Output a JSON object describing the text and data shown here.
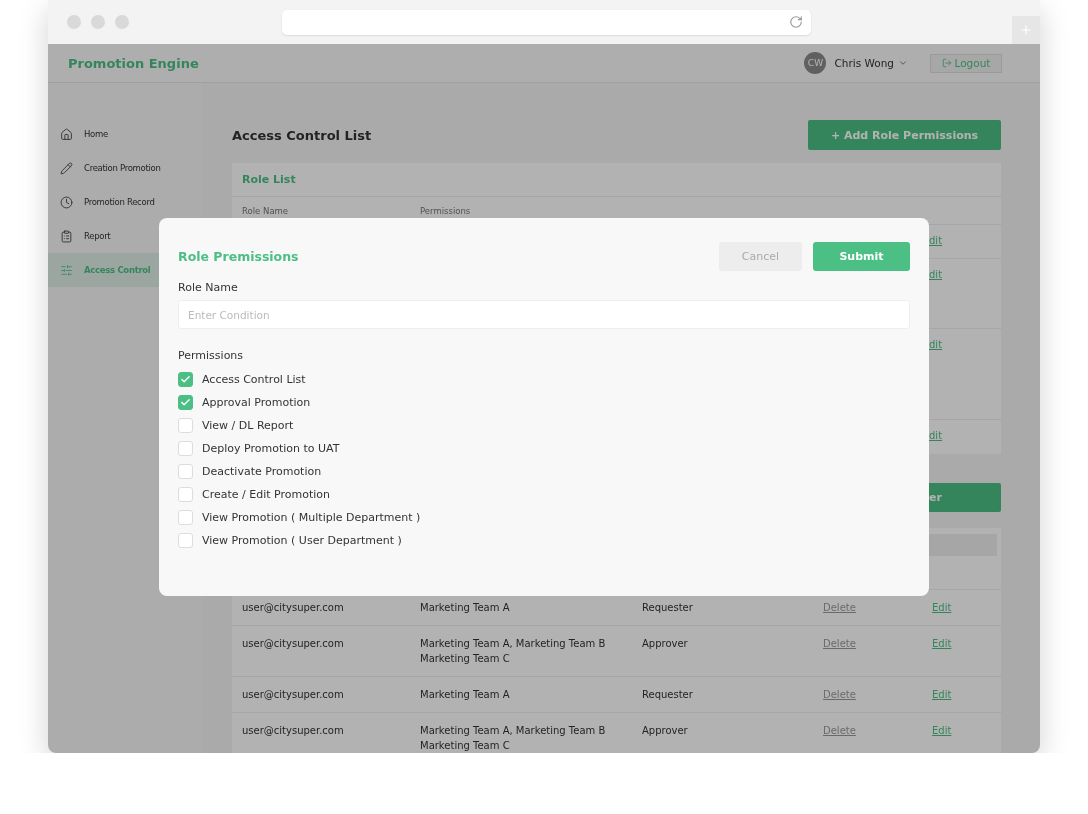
{
  "app": {
    "title": "Promotion Engine",
    "user": {
      "initials": "CW",
      "name": "Chris Wong"
    },
    "logout": "Logout"
  },
  "sidebar": {
    "items": [
      {
        "label": "Home",
        "selected": false
      },
      {
        "label": "Creation Promotion",
        "selected": false
      },
      {
        "label": "Promotion Record",
        "selected": false
      },
      {
        "label": "Report",
        "selected": false
      },
      {
        "label": "Access Control",
        "selected": true
      }
    ]
  },
  "main": {
    "title": "Access Control List",
    "add_button": "+ Add Role Permissions",
    "role_list": {
      "title": "Role List",
      "columns": [
        "Role Name",
        "Permissions"
      ],
      "rows": [
        {
          "action": "dit"
        },
        {
          "action": "dit"
        },
        {
          "action": "dit"
        },
        {
          "action": "dit"
        }
      ]
    },
    "user_section_button": "er",
    "user_rows": [
      {
        "email": "user@citysuper.com",
        "teams": [
          "Marketing Team A"
        ],
        "role": "Requester",
        "delete": "Delete",
        "edit": "Edit"
      },
      {
        "email": "user@citysuper.com",
        "teams": [
          "Marketing Team A, Marketing Team B",
          "Marketing Team C"
        ],
        "role": "Approver",
        "delete": "Delete",
        "edit": "Edit"
      },
      {
        "email": "user@citysuper.com",
        "teams": [
          "Marketing Team A"
        ],
        "role": "Requester",
        "delete": "Delete",
        "edit": "Edit"
      },
      {
        "email": "user@citysuper.com",
        "teams": [
          "Marketing Team A, Marketing Team B",
          "Marketing Team C"
        ],
        "role": "Approver",
        "delete": "Delete",
        "edit": "Edit"
      }
    ]
  },
  "modal": {
    "title": "Role Premissions",
    "cancel": "Cancel",
    "submit": "Submit",
    "role_name_label": "Role Name",
    "placeholder": "Enter Condition",
    "permissions_label": "Permissions",
    "permissions": [
      {
        "label": "Access Control List",
        "checked": true
      },
      {
        "label": "Approval Promotion",
        "checked": true
      },
      {
        "label": "View / DL Report",
        "checked": false
      },
      {
        "label": "Deploy Promotion to UAT",
        "checked": false
      },
      {
        "label": "Deactivate Promotion",
        "checked": false
      },
      {
        "label": "Create / Edit Promotion",
        "checked": false
      },
      {
        "label": "View Promotion ( Multiple Department )",
        "checked": false
      },
      {
        "label": "View Promotion ( User Department )",
        "checked": false
      }
    ]
  }
}
